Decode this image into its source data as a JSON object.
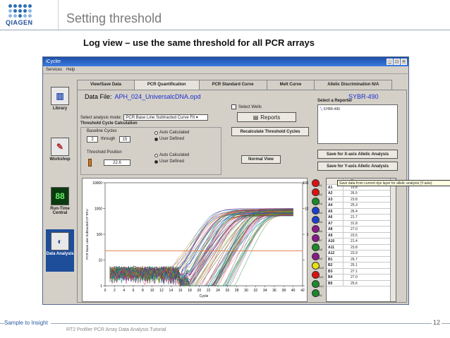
{
  "slide": {
    "logo_text": "QIAGEN",
    "title": "Setting threshold",
    "subtitle": "Log view – use the same threshold for all PCR arrays",
    "footer_left": "Sample to Insight",
    "footer_mid": "RT2 Profiler PCR Array Data Analysis Tutorial",
    "page_number": "12"
  },
  "window": {
    "title": "iCycler",
    "menu": [
      "Services",
      "Help"
    ],
    "nav": [
      {
        "label": "Library",
        "icon": "library-icon"
      },
      {
        "label": "Workshop",
        "icon": "workshop-icon"
      },
      {
        "label": "Run-Time Central",
        "icon": "runtime-icon"
      },
      {
        "label": "Data Analysis",
        "icon": "data-analysis-icon"
      }
    ],
    "tabs": [
      "View/Save Data",
      "PCR Quantification",
      "PCR Standard Curve",
      "Melt Curve",
      "Allelic Discrimination N/A"
    ],
    "active_tab": "PCR Quantification"
  },
  "panel": {
    "data_file_label": "Data File:",
    "data_file_name": "APH_024_UniversalcDNA.opd",
    "dye": "SYBR-490",
    "select_wells": "Select Wells",
    "reports": "Reports",
    "analysis_mode_label": "Select analysis mode:",
    "analysis_mode_value": "PCR Base Line Subtracted Curve Fit",
    "threshold_calc_title": "Threshold Cycle Calculation",
    "baseline_cycles_label": "Baseline Cycles",
    "baseline_from": "2",
    "through_label": "through",
    "baseline_to": "15",
    "auto_calculated": "Auto Calculated",
    "user_defined": "User Defined",
    "threshold_position_label": "Threshold Position",
    "threshold_value": "22.6",
    "recalc_button": "Recalculate Threshold Cycles",
    "normal_view_button": "Normal View",
    "reporter_title": "Select a Reporter",
    "reporter_item": "SYBR-490",
    "save_x_button": "Save for X-axis Allelic Analysis",
    "save_y_button": "Save for Y-axis Allelic Analysis",
    "tooltip": "Save data from current dye layer for allelic analysis (Y-axis)."
  },
  "chart_data": {
    "type": "line",
    "xlabel": "Cycle",
    "ylabel": "PCR Base Line Subtracted CF RFU",
    "log_scale_y": true,
    "xlim": [
      0,
      42
    ],
    "ylim": [
      1,
      10000
    ],
    "x_ticks": [
      "0",
      "2",
      "4",
      "6",
      "8",
      "10",
      "12",
      "14",
      "16",
      "18",
      "20",
      "22",
      "24",
      "26",
      "28",
      "30",
      "32",
      "34",
      "36",
      "38",
      "40",
      "42"
    ],
    "y_ticks": [
      "1",
      "10",
      "100",
      "1000",
      "10000"
    ],
    "threshold": 22.6,
    "threshold_color": "#e8743a",
    "series_count": 96,
    "series_midpoint_range": [
      22,
      35
    ],
    "plateau_range": [
      500,
      1000
    ]
  },
  "wells": [
    {
      "label": "A1",
      "color": "#e01010"
    },
    {
      "label": "A2",
      "color": "#e01010"
    },
    {
      "label": "A3",
      "color": "#1a8a2a"
    },
    {
      "label": "A4",
      "color": "#1a40d0"
    },
    {
      "label": "A5",
      "color": "#1a40d0"
    },
    {
      "label": "A6",
      "color": "#8a1a8a"
    },
    {
      "label": "A7",
      "color": "#8a1a8a"
    },
    {
      "label": "A8",
      "color": "#1a8a2a"
    },
    {
      "label": "A9",
      "color": "#8a1a8a"
    },
    {
      "label": "A10",
      "color": "#e8e010"
    },
    {
      "label": "A11",
      "color": "#e01010"
    },
    {
      "label": "A12",
      "color": "#1a8a2a"
    },
    {
      "label": "B1",
      "color": "#1a8a2a"
    }
  ],
  "ct_table": {
    "header": [
      "",
      "Ct"
    ],
    "rows": [
      [
        "A1",
        "19.8"
      ],
      [
        "A2",
        "26.5"
      ],
      [
        "A3",
        "23.8"
      ],
      [
        "A4",
        "25.3"
      ],
      [
        "A5",
        "26.4"
      ],
      [
        "A6",
        "21.7"
      ],
      [
        "A7",
        "31.8"
      ],
      [
        "A8",
        "27.0"
      ],
      [
        "A9",
        "23.5"
      ],
      [
        "A10",
        "21.4"
      ],
      [
        "A11",
        "23.8"
      ],
      [
        "A12",
        "23.9"
      ],
      [
        "B1",
        "26.7"
      ],
      [
        "B2",
        "25.1"
      ],
      [
        "B3",
        "27.1"
      ],
      [
        "B4",
        "27.0"
      ],
      [
        "B5",
        "25.6"
      ]
    ]
  }
}
